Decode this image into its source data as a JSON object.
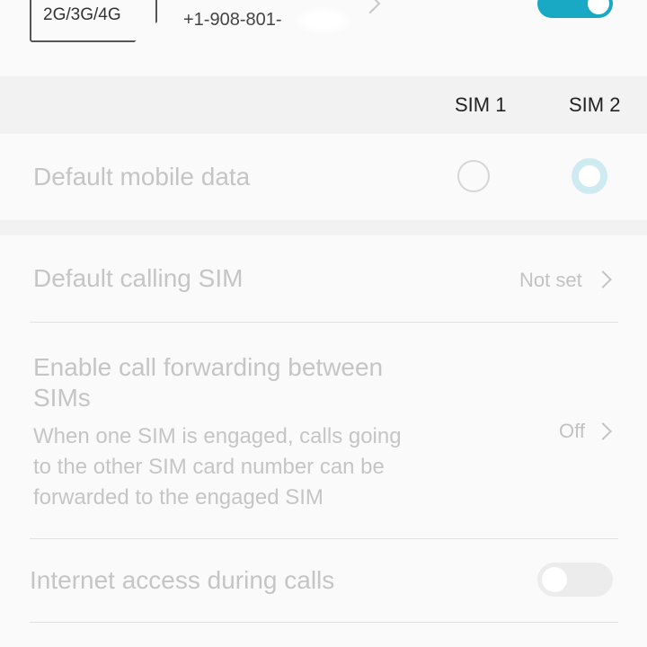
{
  "sim_card": {
    "network_label": "2G/3G/4G",
    "phone_number": "+1-908-801-"
  },
  "sim_header": {
    "sim1": "SIM 1",
    "sim2": "SIM 2"
  },
  "default_mobile_data": {
    "label": "Default mobile data",
    "selected": "SIM 2"
  },
  "settings": {
    "default_calling_sim": {
      "label": "Default calling SIM",
      "value": "Not set"
    },
    "call_forwarding": {
      "title_line1": "Enable call forwarding between",
      "title_line2": "SIMs",
      "desc_line1": "When one SIM is engaged, calls going",
      "desc_line2": "to the other SIM card number can be",
      "desc_line3": "forwarded to the engaged SIM",
      "value": "Off"
    },
    "internet_during_calls": {
      "label": "Internet access during calls",
      "enabled": false
    }
  },
  "colors": {
    "accent": "#1aa9c5",
    "disabled_text": "#c5c5c5",
    "header_band": "#f2f2f2"
  },
  "icons": [
    "sim-card-icon",
    "chevron-right-icon",
    "toggle-switch-icon",
    "radio-button-icon"
  ]
}
